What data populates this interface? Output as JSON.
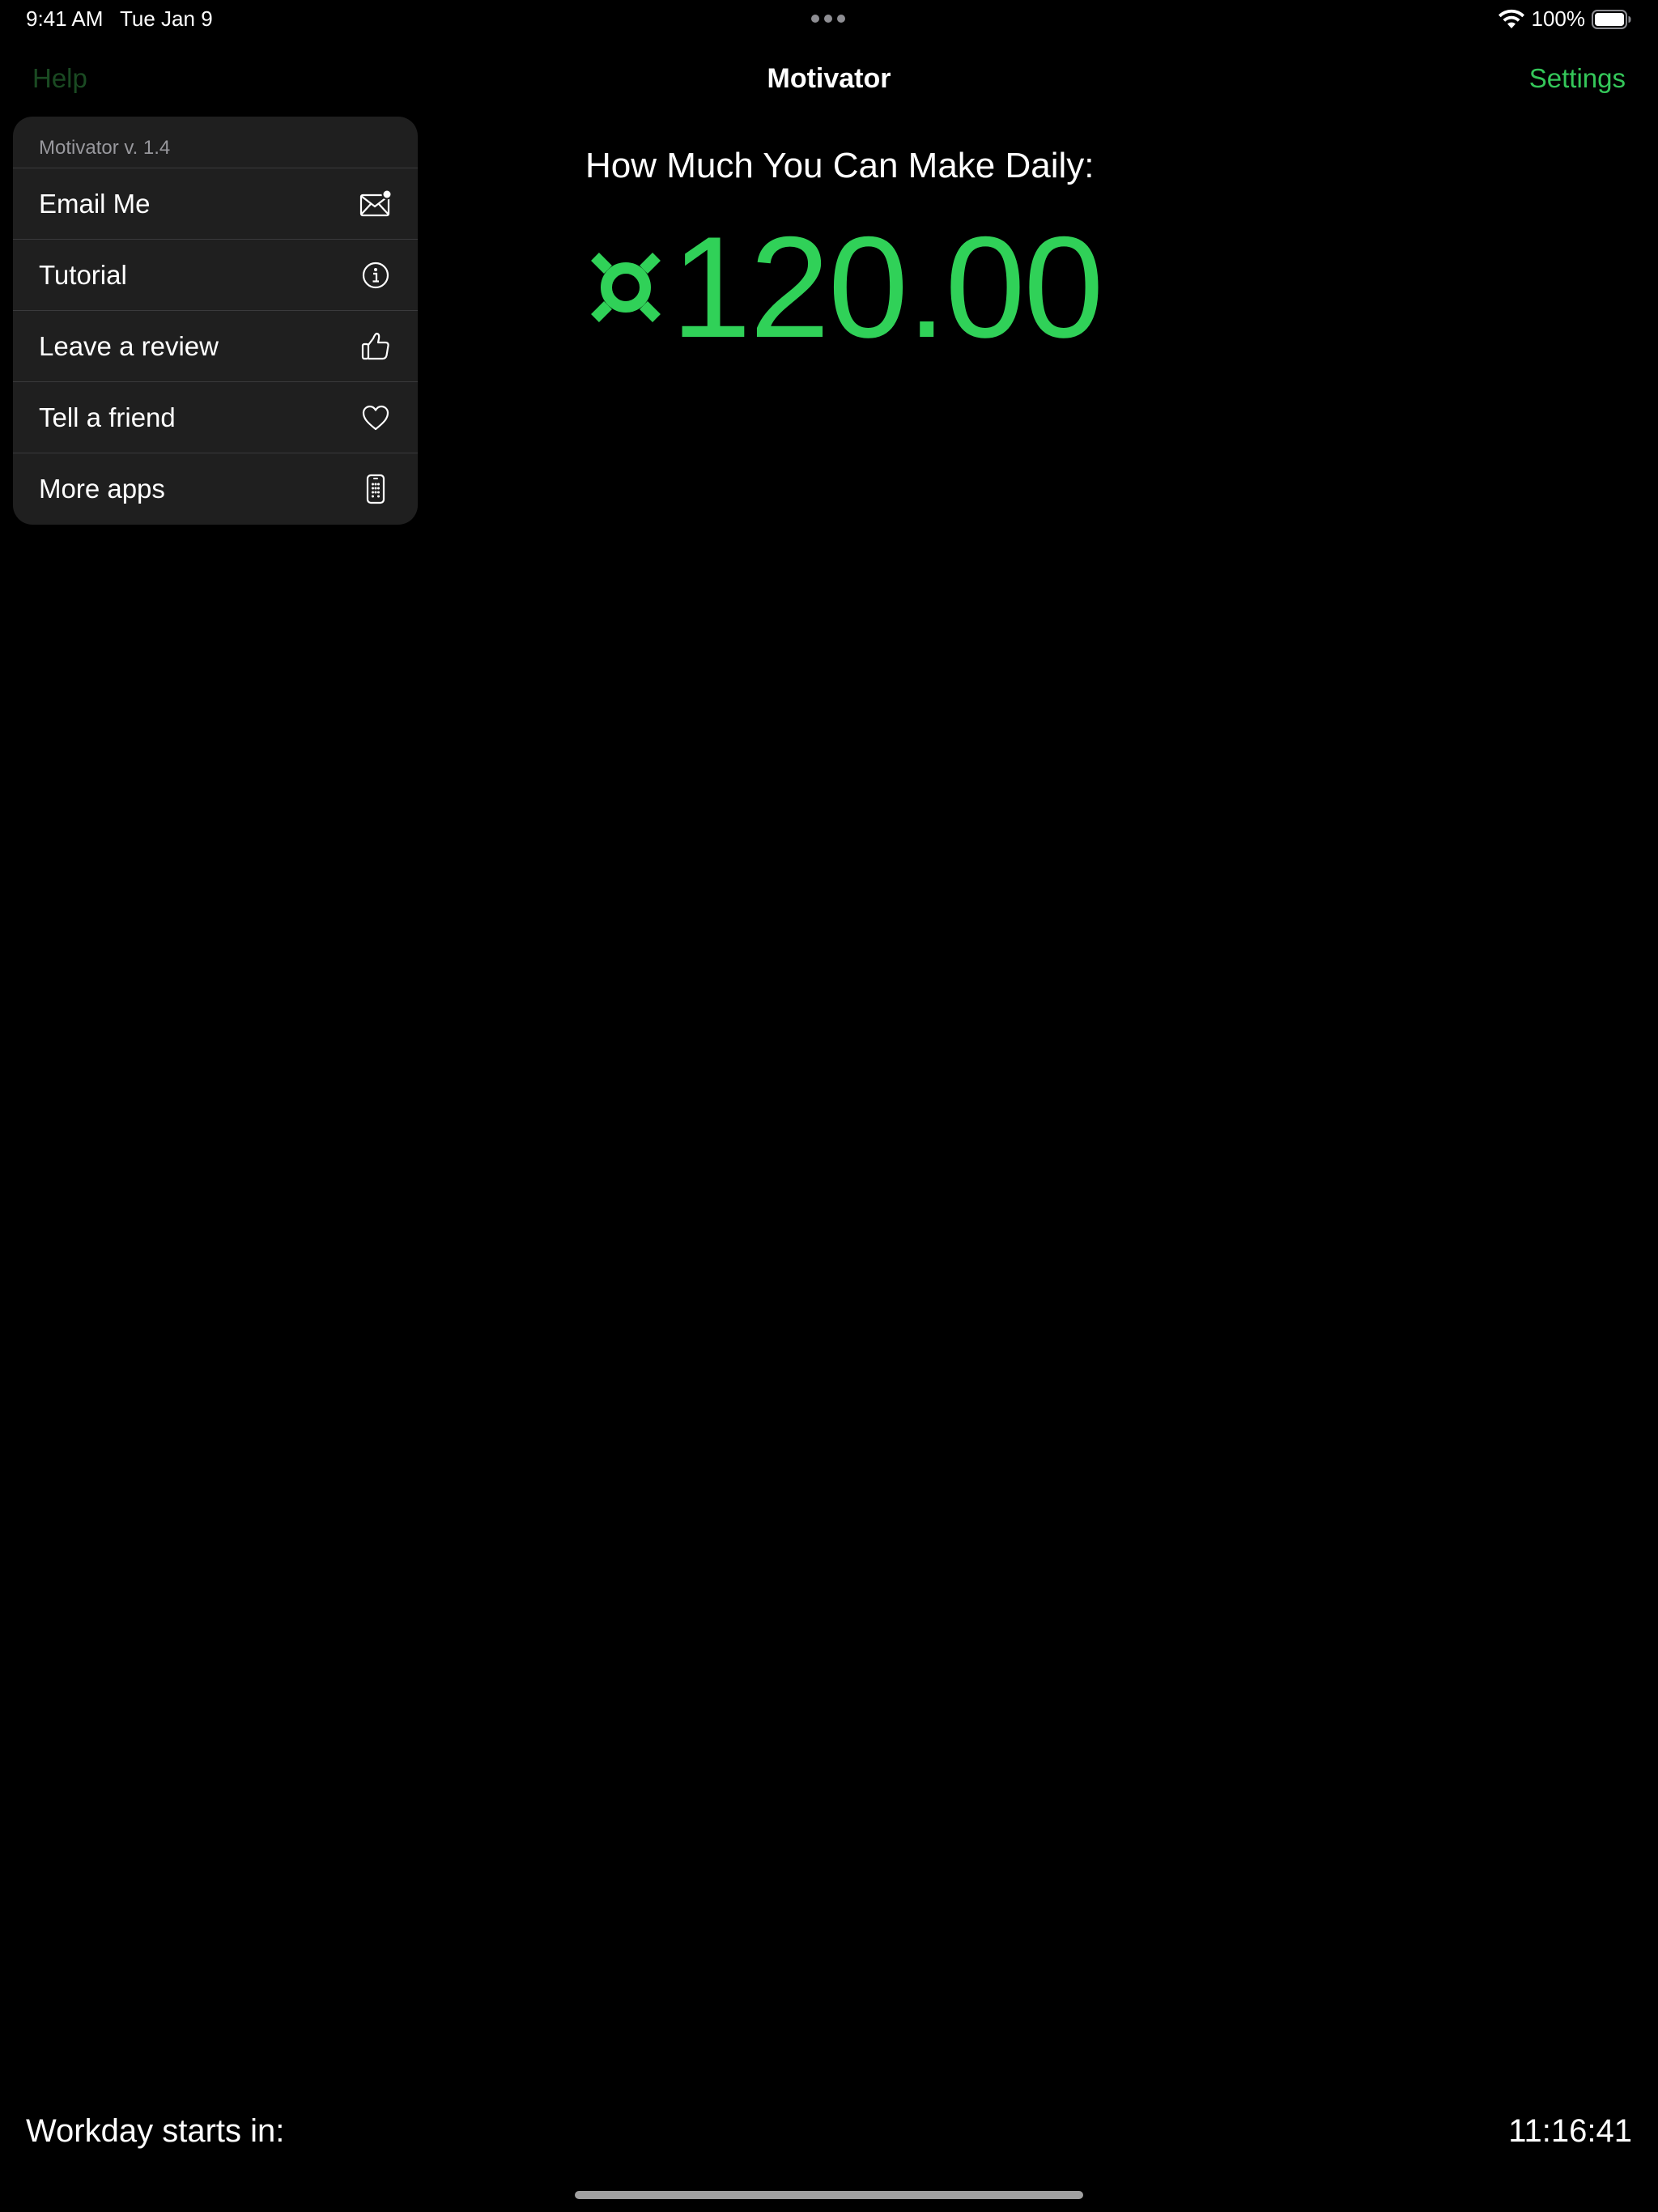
{
  "status_bar": {
    "time": "9:41 AM",
    "date": "Tue Jan 9",
    "battery_percent": "100%",
    "wifi_icon": "wifi-icon",
    "battery_icon": "battery-full-icon"
  },
  "nav": {
    "help_label": "Help",
    "title": "Motivator",
    "settings_label": "Settings"
  },
  "menu": {
    "header": "Motivator v. 1.4",
    "items": [
      {
        "label": "Email Me",
        "icon": "envelope-badge-icon"
      },
      {
        "label": "Tutorial",
        "icon": "info-circle-icon"
      },
      {
        "label": "Leave a review",
        "icon": "thumbs-up-icon"
      },
      {
        "label": "Tell a friend",
        "icon": "heart-icon"
      },
      {
        "label": "More apps",
        "icon": "iphone-apps-icon"
      }
    ]
  },
  "main": {
    "headline": "How Much You Can Make Daily:",
    "currency_icon": "generic-currency-icon",
    "amount": "120.00"
  },
  "footer": {
    "label": "Workday starts in:",
    "countdown": "11:16:41"
  },
  "colors": {
    "accent": "#30d158",
    "background": "#000000",
    "menu_background": "#1f1f1f",
    "help_dimmed": "#1a4a22"
  }
}
